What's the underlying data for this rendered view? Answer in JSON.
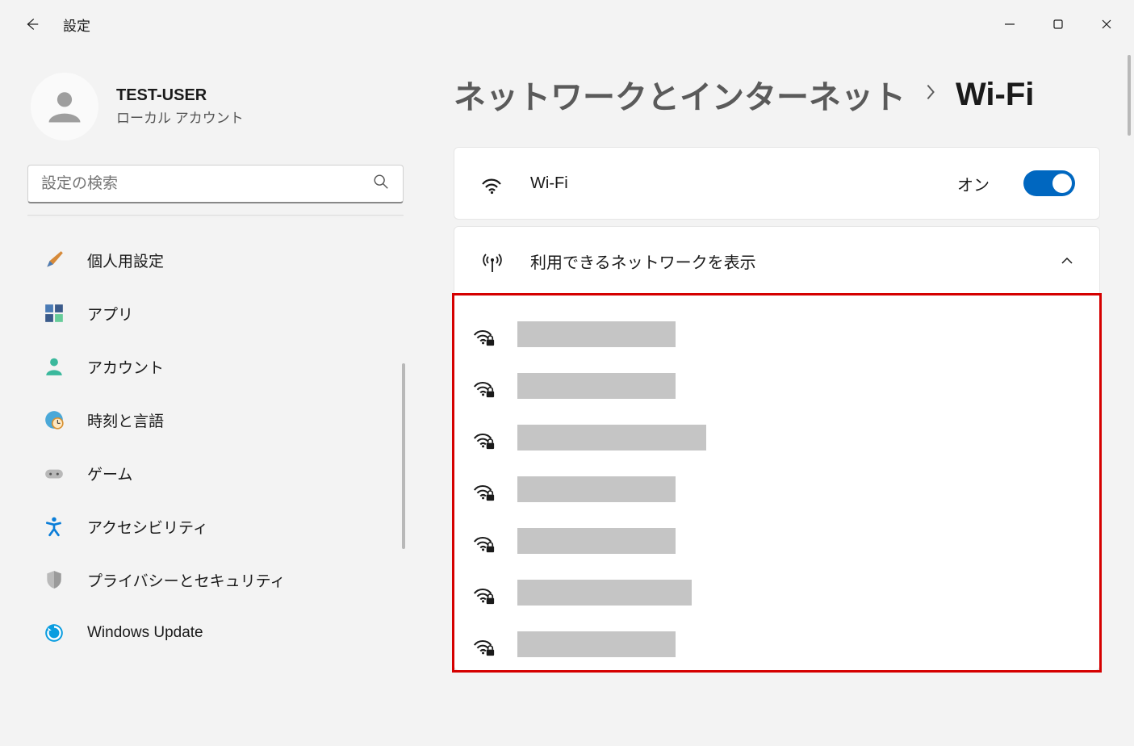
{
  "app": {
    "title": "設定"
  },
  "user": {
    "name": "TEST-USER",
    "account_type": "ローカル アカウント"
  },
  "search": {
    "placeholder": "設定の検索"
  },
  "nav": {
    "items": [
      {
        "label": "個人用設定"
      },
      {
        "label": "アプリ"
      },
      {
        "label": "アカウント"
      },
      {
        "label": "時刻と言語"
      },
      {
        "label": "ゲーム"
      },
      {
        "label": "アクセシビリティ"
      },
      {
        "label": "プライバシーとセキュリティ"
      },
      {
        "label": "Windows Update"
      }
    ]
  },
  "breadcrumb": {
    "parent": "ネットワークとインターネット",
    "current": "Wi-Fi"
  },
  "wifi": {
    "label": "Wi-Fi",
    "toggle_label": "オン",
    "toggle_state": true
  },
  "available": {
    "header": "利用できるネットワークを表示",
    "networks": [
      {
        "secured": true,
        "width": "w190"
      },
      {
        "secured": true,
        "width": "w190"
      },
      {
        "secured": true,
        "width": "w230"
      },
      {
        "secured": true,
        "width": "w190"
      },
      {
        "secured": true,
        "width": "w190"
      },
      {
        "secured": true,
        "width": "w210"
      },
      {
        "secured": true,
        "width": "w190"
      }
    ]
  }
}
